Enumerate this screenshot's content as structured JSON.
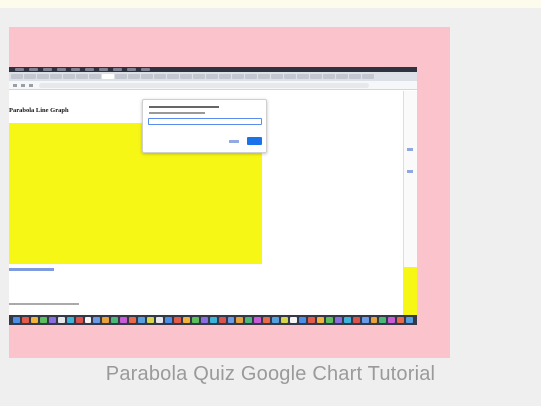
{
  "screenshot": {
    "page_title": "Parabola Line Graph"
  },
  "caption": "Parabola Quiz Google Chart Tutorial",
  "colors": {
    "thumbnail_bg": "#fbc3cb",
    "chart_area": "#f7f716",
    "dialog_ok": "#1a73e8",
    "caption_text": "#9a9a9a"
  },
  "icons": {
    "dock_icons": "mac-dock-app-icons"
  }
}
